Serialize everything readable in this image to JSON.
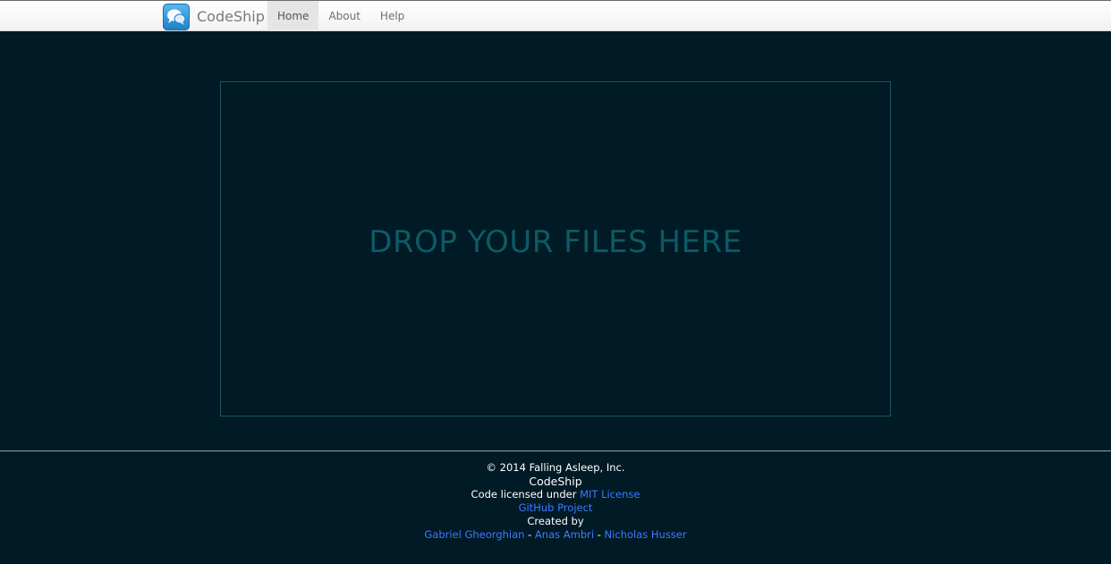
{
  "navbar": {
    "brand_name": "CodeShip",
    "logo_icon": "chat-bubbles-icon",
    "items": [
      {
        "label": "Home",
        "active": true
      },
      {
        "label": "About",
        "active": false
      },
      {
        "label": "Help",
        "active": false
      }
    ]
  },
  "drop_zone": {
    "text": "DROP YOUR FILES HERE"
  },
  "footer": {
    "copyright": "© 2014 Falling Asleep, Inc.",
    "app_name": "CodeShip",
    "license_prefix": "Code licensed under ",
    "license_link": "MIT License",
    "github_link": "GitHub Project",
    "created_by": "Created by",
    "authors": [
      "Gabriel Gheorghian",
      "Anas Ambri",
      "Nicholas Husser"
    ],
    "author_separator": " - "
  },
  "colors": {
    "background": "#001a26",
    "drop_text": "#0d5a66",
    "drop_border": "#1f5660",
    "link": "#3b7cff",
    "logo": "#2b8ad6"
  }
}
